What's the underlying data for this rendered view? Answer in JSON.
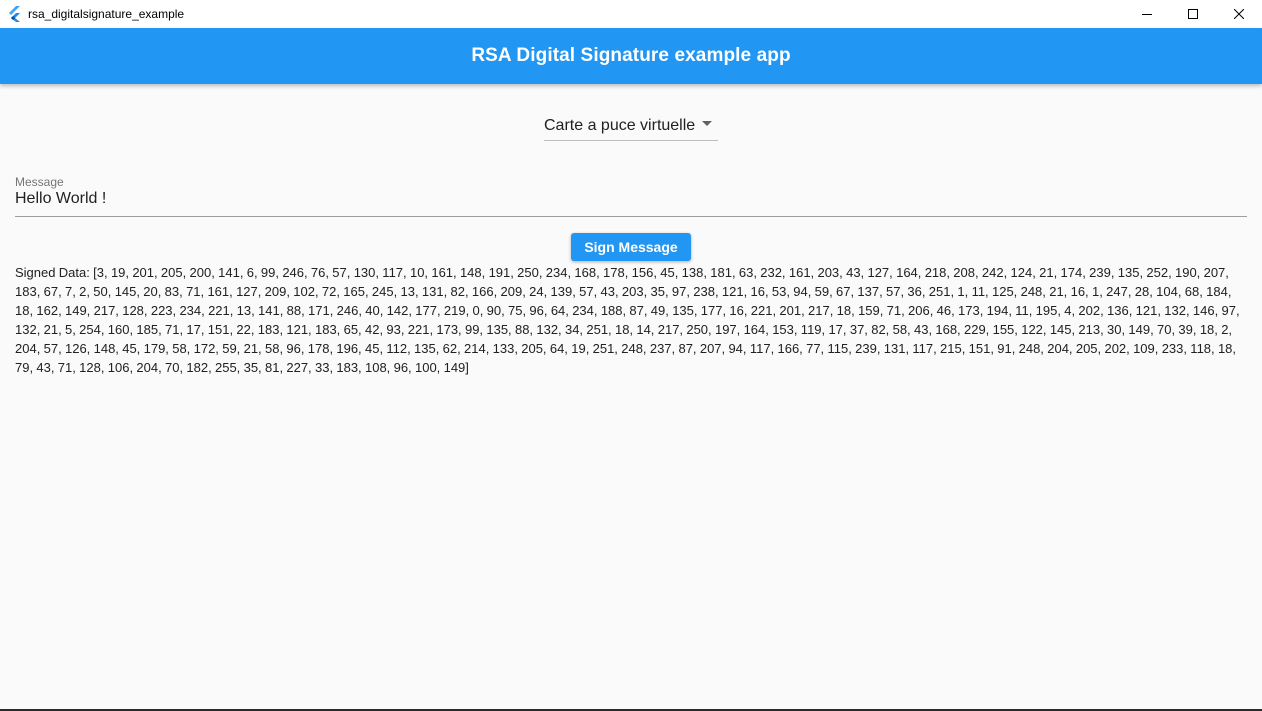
{
  "window": {
    "title": "rsa_digitalsignature_example",
    "controls": [
      "minimize-icon",
      "maximize-icon",
      "close-icon"
    ]
  },
  "appbar": {
    "title": "RSA Digital Signature example app",
    "color": "#2196f3"
  },
  "dropdown": {
    "selected": "Carte a puce virtuelle"
  },
  "message_field": {
    "label": "Message",
    "value": "Hello World !"
  },
  "sign_button": {
    "label": "Sign Message"
  },
  "signed_data": {
    "text": "Signed Data: [3, 19, 201, 205, 200, 141, 6, 99, 246, 76, 57, 130, 117, 10, 161, 148, 191, 250, 234, 168, 178, 156, 45, 138, 181, 63, 232, 161, 203, 43, 127, 164, 218, 208, 242, 124, 21, 174, 239, 135, 252, 190, 207, 183, 67, 7, 2, 50, 145, 20, 83, 71, 161, 127, 209, 102, 72, 165, 245, 13, 131, 82, 166, 209, 24, 139, 57, 43, 203, 35, 97, 238, 121, 16, 53, 94, 59, 67, 137, 57, 36, 251, 1, 11, 125, 248, 21, 16, 1, 247, 28, 104, 68, 184, 18, 162, 149, 217, 128, 223, 234, 221, 13, 141, 88, 171, 246, 40, 142, 177, 219, 0, 90, 75, 96, 64, 234, 188, 87, 49, 135, 177, 16, 221, 201, 217, 18, 159, 71, 206, 46, 173, 194, 11, 195, 4, 202, 136, 121, 132, 146, 97, 132, 21, 5, 254, 160, 185, 71, 17, 151, 22, 183, 121, 183, 65, 42, 93, 221, 173, 99, 135, 88, 132, 34, 251, 18, 14, 217, 250, 197, 164, 153, 119, 17, 37, 82, 58, 43, 168, 229, 155, 122, 145, 213, 30, 149, 70, 39, 18, 2, 204, 57, 126, 148, 45, 179, 58, 172, 59, 21, 58, 96, 178, 196, 45, 112, 135, 62, 214, 133, 205, 64, 19, 251, 248, 237, 87, 207, 94, 117, 166, 77, 115, 239, 131, 117, 215, 151, 91, 248, 204, 205, 202, 109, 233, 118, 18, 79, 43, 71, 128, 106, 204, 70, 182, 255, 35, 81, 227, 33, 183, 108, 96, 100, 149]"
  }
}
